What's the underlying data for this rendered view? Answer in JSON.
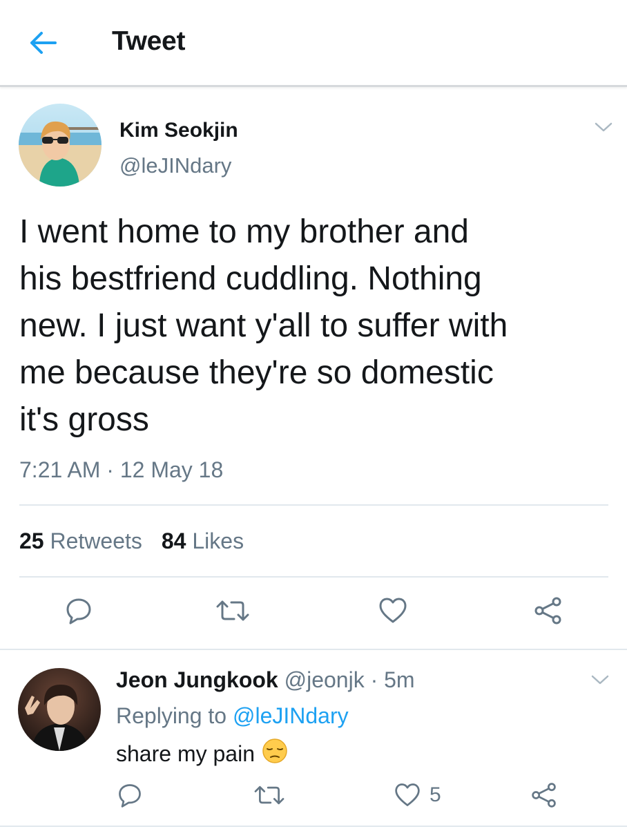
{
  "header": {
    "title": "Tweet",
    "back_icon": "arrow-left-icon",
    "accent_color": "#1da1f2"
  },
  "tweet": {
    "author_name": "Kim Seokjin",
    "author_handle": "@leJINdary",
    "text": "I went home to my brother and\nhis bestfriend cuddling. Nothing\nnew. I just want y'all to suffer with\nme because they're so domestic\nit's gross",
    "timestamp": "7:21 AM · 12 May 18",
    "retweets_count": "25",
    "retweets_label": "Retweets",
    "likes_count": "84",
    "likes_label": "Likes",
    "actions": [
      "reply-icon",
      "retweet-icon",
      "heart-icon",
      "share-icon"
    ]
  },
  "reply": {
    "author_name": "Jeon Jungkook",
    "author_handle": "@jeonjk",
    "separator": " · ",
    "time_ago": "5m",
    "replying_prefix": "Replying to",
    "replying_to": "@leJINdary",
    "text": "share my pain",
    "emoji": "pensive-face-emoji",
    "like_count": "5",
    "actions": [
      "reply-icon",
      "retweet-icon",
      "heart-icon",
      "share-icon"
    ]
  },
  "colors": {
    "text_primary": "#14171a",
    "text_secondary": "#657786",
    "link": "#1da1f2",
    "divider": "#e1e8ed"
  }
}
